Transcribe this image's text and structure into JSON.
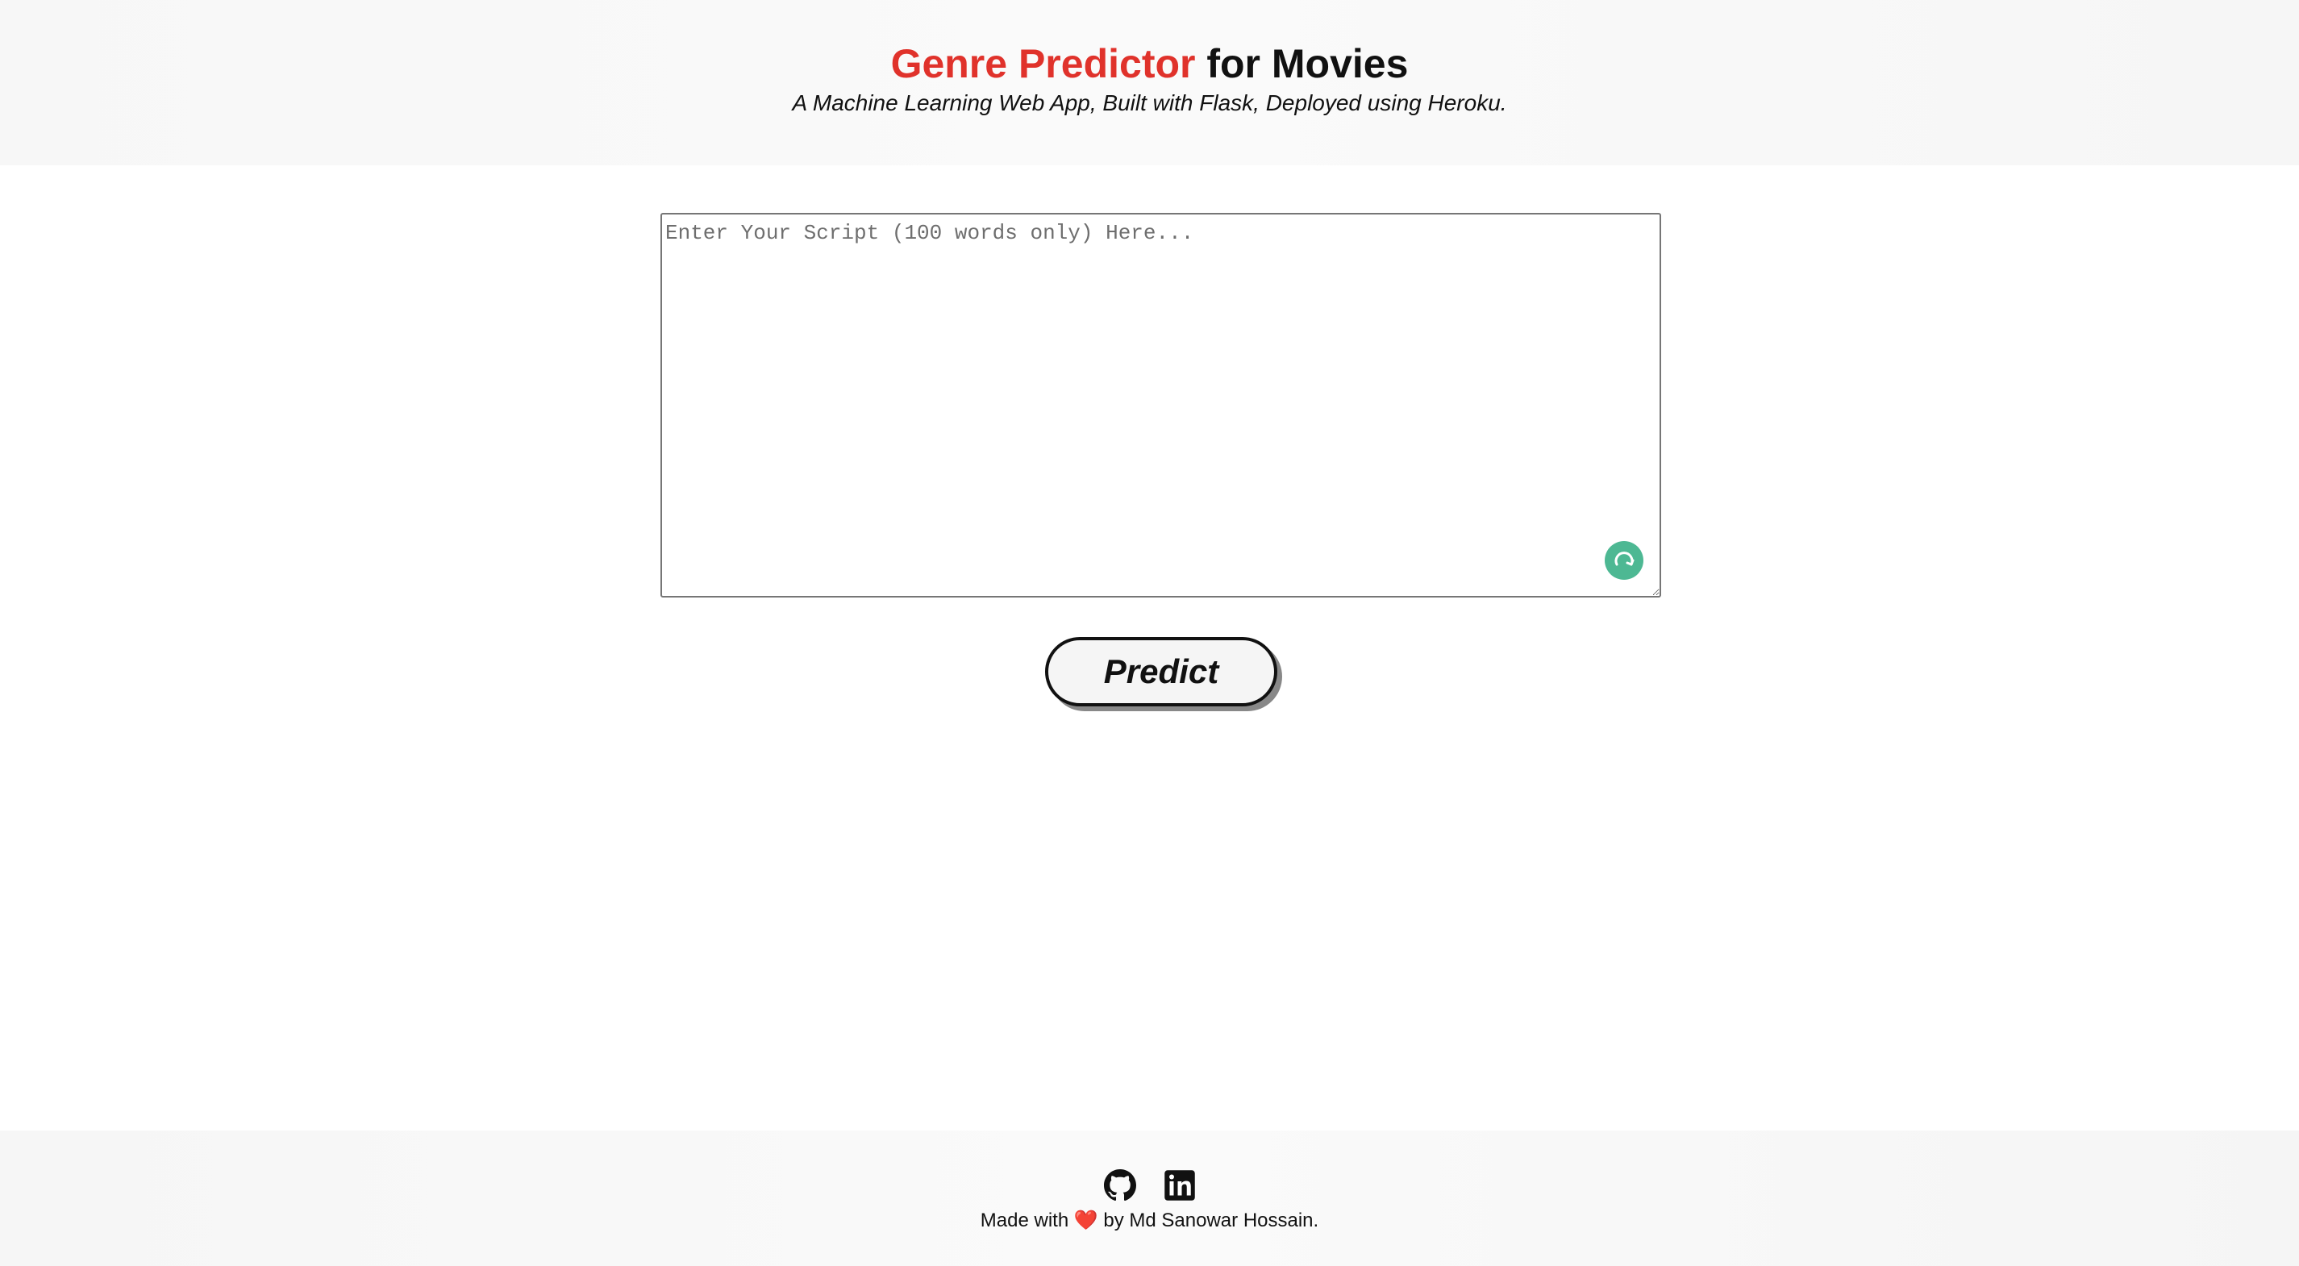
{
  "header": {
    "title_accent": "Genre Predictor",
    "title_rest": " for Movies",
    "subtitle": "A Machine Learning Web App, Built with Flask, Deployed using Heroku."
  },
  "form": {
    "script_placeholder": "Enter Your Script (100 words only) Here...",
    "script_value": "",
    "predict_label": "Predict"
  },
  "footer": {
    "social_links": [
      {
        "icon": "github-icon"
      },
      {
        "icon": "linkedin-icon"
      }
    ],
    "credit_prefix": "Made with ",
    "heart": "❤️",
    "credit_suffix": " by Md Sanowar Hossain."
  },
  "colors": {
    "accent": "#e0322b",
    "assistant_badge": "#4db893",
    "text": "#111111"
  }
}
